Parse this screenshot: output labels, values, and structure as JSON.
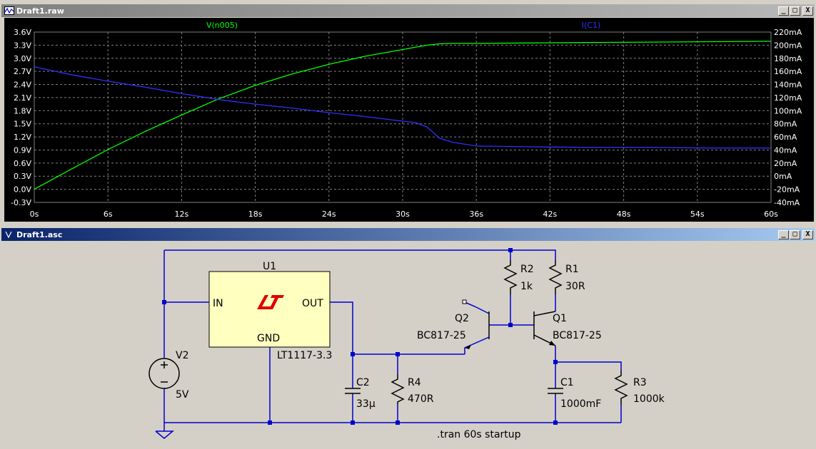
{
  "waveform_window": {
    "title": "Draft1.raw",
    "buttons": {
      "minimize": "_",
      "maximize": "□",
      "close": "X"
    },
    "plot": {
      "trace_names": [
        "V(n005)",
        "I(C1)"
      ],
      "trace_colors": {
        "V(n005)": "#00ff00",
        "I(C1)": "#3030ff"
      },
      "left_ticks": [
        "3.6V",
        "3.3V",
        "3.0V",
        "2.7V",
        "2.4V",
        "2.1V",
        "1.8V",
        "1.5V",
        "1.2V",
        "0.9V",
        "0.6V",
        "0.3V",
        "0.0V",
        "-0.3V"
      ],
      "right_ticks": [
        "220mA",
        "200mA",
        "180mA",
        "160mA",
        "140mA",
        "120mA",
        "100mA",
        "80mA",
        "60mA",
        "40mA",
        "20mA",
        "0mA",
        "-20mA",
        "-40mA"
      ],
      "x_ticks": [
        "0s",
        "6s",
        "12s",
        "18s",
        "24s",
        "30s",
        "36s",
        "42s",
        "48s",
        "54s",
        "60s"
      ]
    }
  },
  "schematic_window": {
    "title": "Draft1.asc",
    "buttons": {
      "minimize": "_",
      "maximize": "□",
      "close": "X"
    },
    "components": {
      "u1": {
        "ref": "U1",
        "pin_in": "IN",
        "pin_out": "OUT",
        "pin_gnd": "GND",
        "value": "LT1117-3.3"
      },
      "v2": {
        "ref": "V2",
        "value": "5V"
      },
      "r1": {
        "ref": "R1",
        "value": "30R"
      },
      "r2": {
        "ref": "R2",
        "value": "1k"
      },
      "r3": {
        "ref": "R3",
        "value": "1000k"
      },
      "r4": {
        "ref": "R4",
        "value": "470R"
      },
      "c1": {
        "ref": "C1",
        "value": "1000mF"
      },
      "c2": {
        "ref": "C2",
        "value": "33µ"
      },
      "q1": {
        "ref": "Q1",
        "value": "BC817-25"
      },
      "q2": {
        "ref": "Q2",
        "value": "BC817-25"
      }
    },
    "directive": ".tran 60s startup"
  },
  "chart_data": {
    "type": "line",
    "x": [
      0,
      3,
      6,
      9,
      12,
      15,
      18,
      21,
      24,
      27,
      30,
      31,
      32,
      33,
      34,
      36,
      40,
      45,
      50,
      55,
      60
    ],
    "series": [
      {
        "name": "V(n005)",
        "axis": "left",
        "values": [
          0.0,
          0.46,
          0.91,
          1.32,
          1.7,
          2.07,
          2.38,
          2.64,
          2.86,
          3.05,
          3.2,
          3.25,
          3.3,
          3.33,
          3.34,
          3.34,
          3.35,
          3.36,
          3.37,
          3.38,
          3.39
        ]
      },
      {
        "name": "I(C1)",
        "axis": "right",
        "values": [
          167,
          155,
          145,
          136,
          126,
          117,
          110,
          104,
          97,
          91,
          84,
          82,
          75,
          58,
          52,
          46,
          45,
          44,
          44,
          43,
          43
        ]
      }
    ],
    "xlim": [
      0,
      60
    ],
    "ylim_left": [
      -0.3,
      3.6
    ],
    "ylim_right": [
      -40,
      220
    ],
    "xlabel": "",
    "ylabel": "",
    "grid": true,
    "legend": "top"
  }
}
